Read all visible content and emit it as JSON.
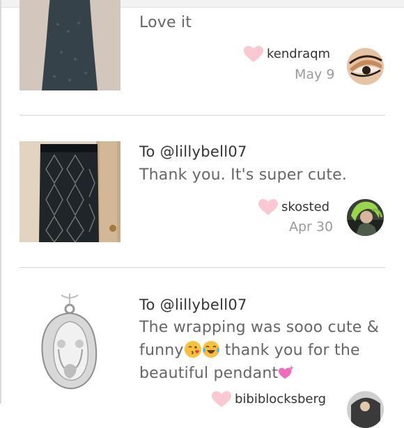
{
  "reviews": [
    {
      "to": "",
      "text": "Love it",
      "username": "kendraqm",
      "date": "May 9",
      "thumb_icon": "tank-dress-image",
      "avatar_icon": "eye-makeup-avatar"
    },
    {
      "to": "To @lillybell07",
      "text": "Thank you. It's super cute.",
      "username": "skosted",
      "date": "Apr 30",
      "thumb_icon": "pencil-skirt-image",
      "avatar_icon": "green-hair-avatar"
    },
    {
      "to": "To @lillybell07",
      "text_line1": "The wrapping was sooo cute &",
      "text_line2_a": "funny",
      "text_line2_b": " thank you for the",
      "text_line3": "beautiful pendant",
      "username": "bibiblocksberg",
      "thumb_icon": "silver-pendant-image",
      "avatar_icon": "partial-avatar"
    }
  ],
  "colors": {
    "heart": "#f9c8d0",
    "username": "#333333",
    "date": "#9a9a9a",
    "separator": "#d6d6d6"
  }
}
